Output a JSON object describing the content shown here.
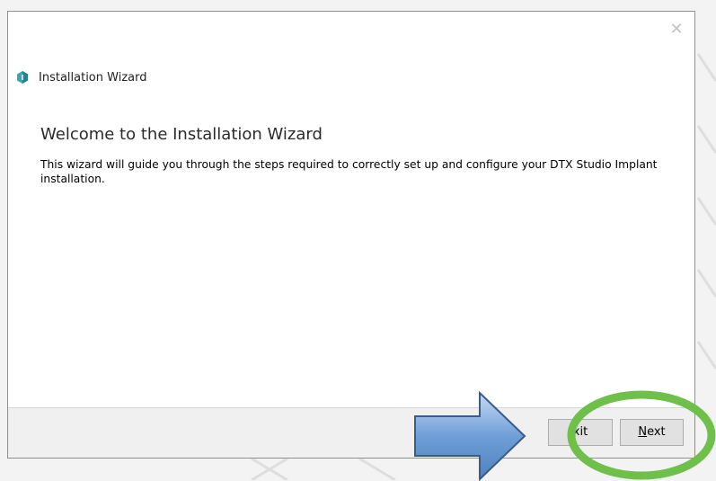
{
  "window": {
    "title": "Installation Wizard",
    "close_glyph": "✕",
    "app_icon": "hexagon-app-icon",
    "accent": "#3aa6b3"
  },
  "content": {
    "heading": "Welcome to the Installation Wizard",
    "description": "This wizard will guide you through the steps required to correctly set up and configure your DTX Studio Implant installation."
  },
  "footer": {
    "exit_label_visible": "xit",
    "next_mnemonic": "N",
    "next_rest": "ext"
  },
  "annotations": {
    "arrow_color": "#4f81bd",
    "circle_color": "#6fbf4b",
    "arrow_icon": "right-arrow-icon",
    "circle_shape": "highlight-ellipse"
  }
}
